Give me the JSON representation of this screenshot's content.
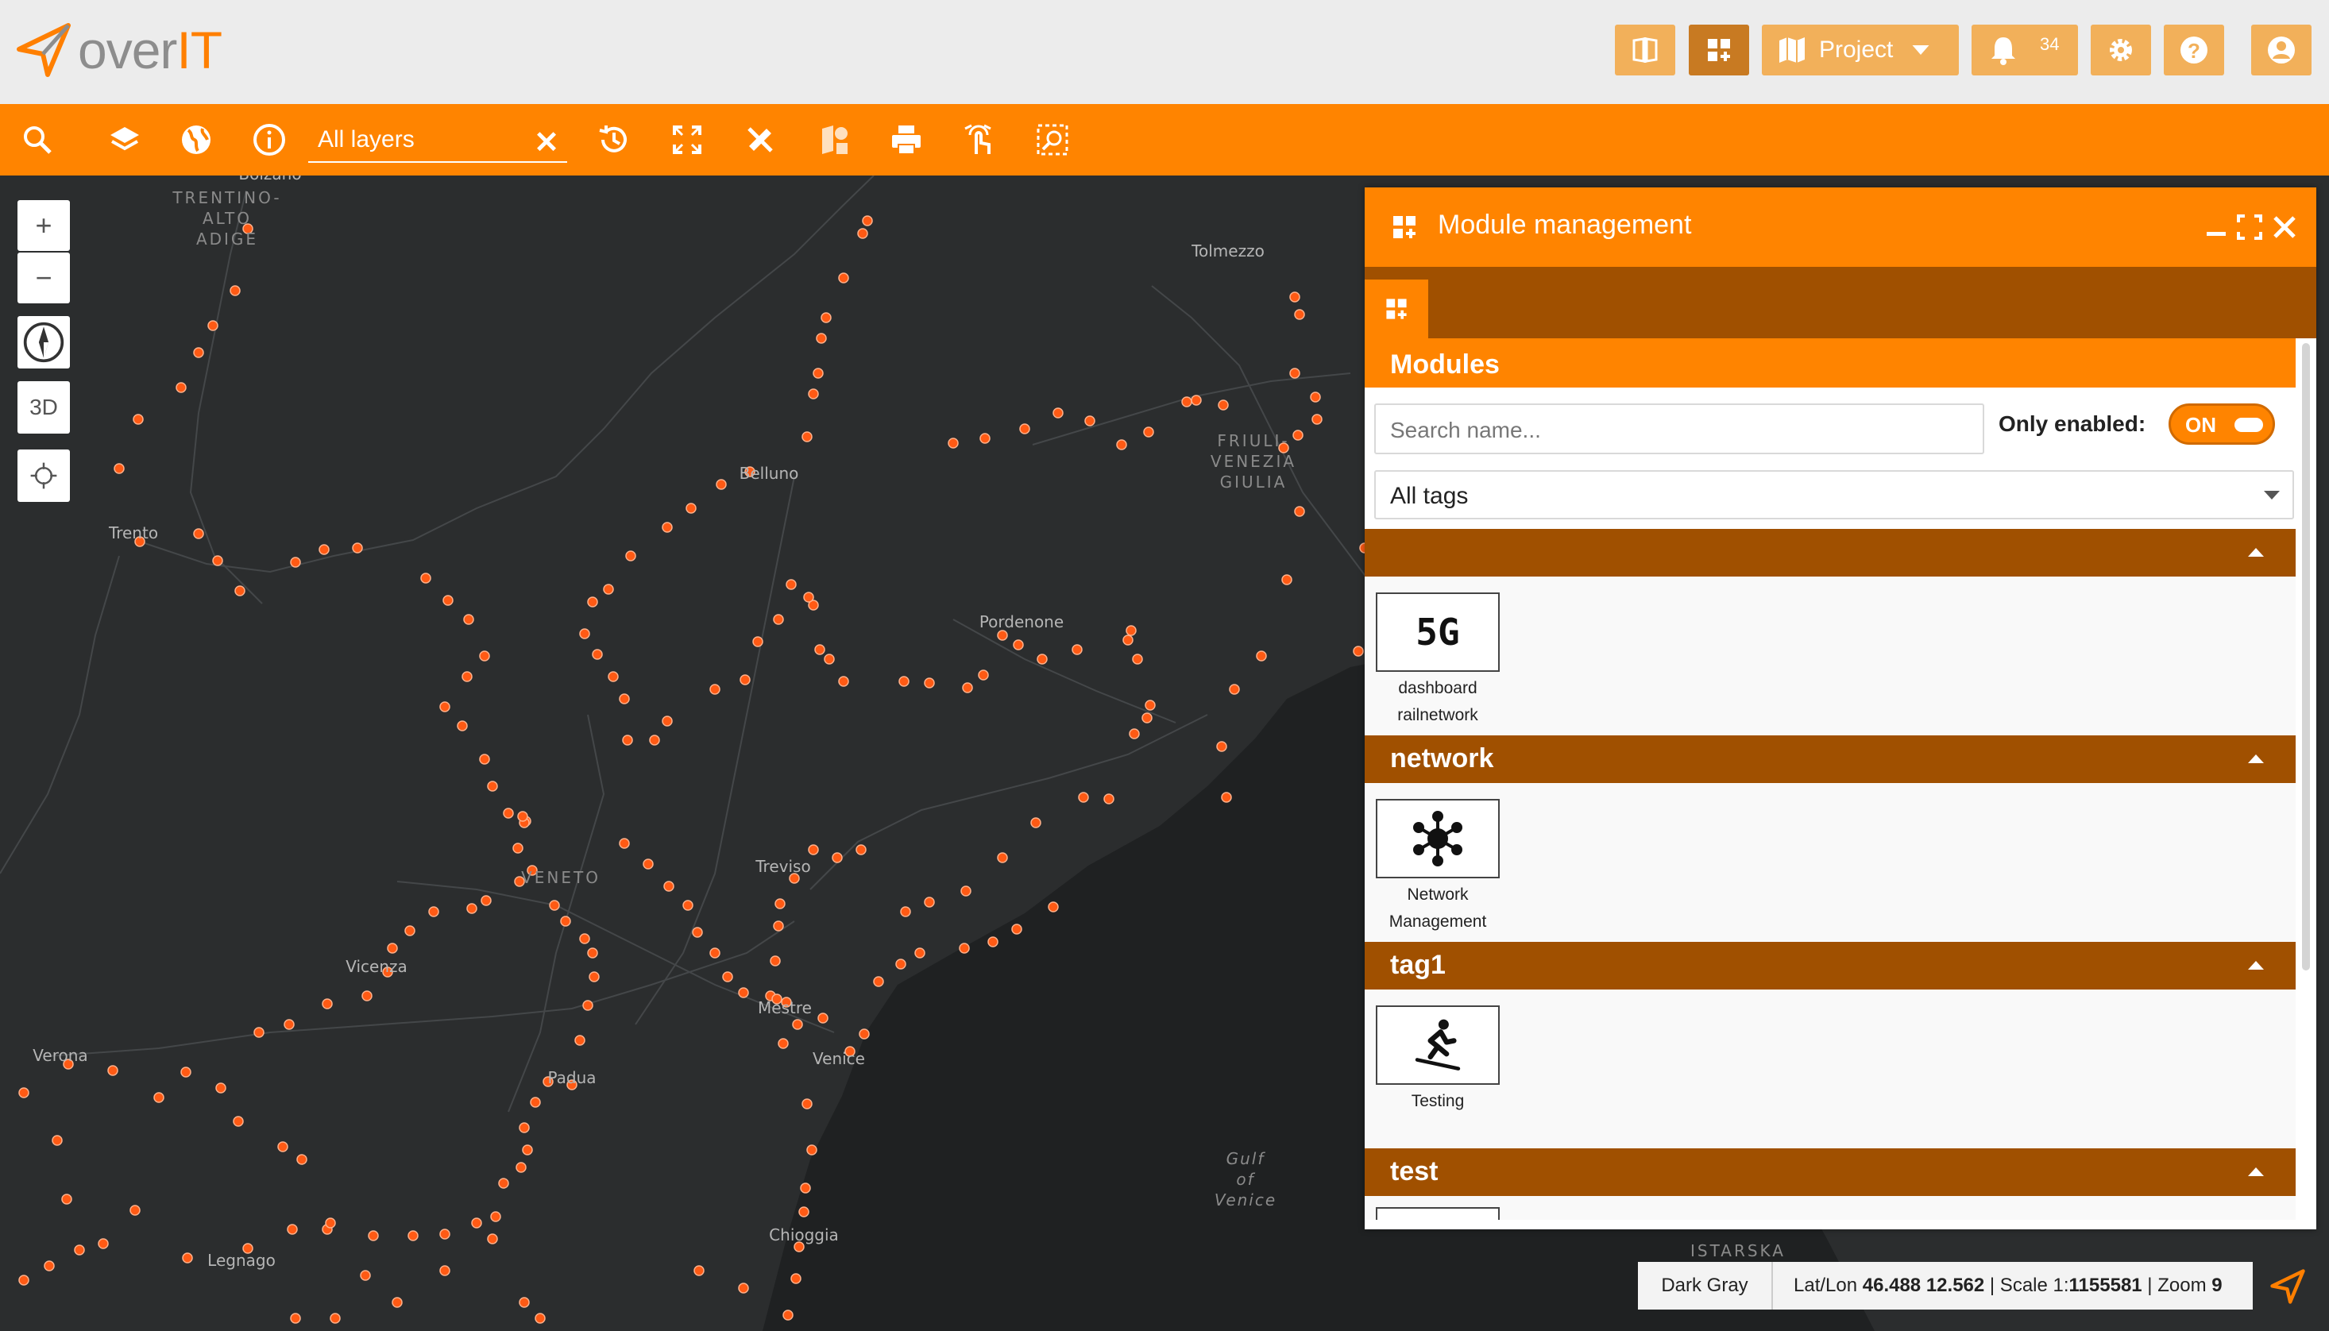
{
  "app": {
    "logo_text_plain": "over",
    "logo_text_accent": "IT"
  },
  "header": {
    "project_label": "Project",
    "notifications_count": "34",
    "buttons": [
      "split-view-icon",
      "module-add-icon",
      "map-icon",
      "bell-icon",
      "gear-icon",
      "help-icon",
      "user-icon"
    ]
  },
  "toolbar": {
    "layer_filter_value": "All layers",
    "clear_symbol": "✕",
    "tools": [
      "search-icon",
      "layers-icon",
      "globe-icon",
      "info-icon",
      "history-icon",
      "fullscreen-icon",
      "measure-icon",
      "select-features-icon",
      "print-icon",
      "touch-icon",
      "zoom-select-icon"
    ]
  },
  "map": {
    "controls": {
      "zoom_in": "+",
      "zoom_out": "−",
      "mode_3d": "3D"
    },
    "labels": {
      "bolzano": "Bolzano",
      "trentino1": "TRENTINO-",
      "trentino2": "ALTO",
      "trentino3": "ADIGE",
      "tolmezzo": "Tolmezzo",
      "friuli1": "FRIULI-",
      "friuli2": "VENEZIA",
      "friuli3": "GIULIA",
      "belluno": "Belluno",
      "trento": "Trento",
      "pordenone": "Pordenone",
      "veneto": "VENETO",
      "treviso": "Treviso",
      "vicenza": "Vicenza",
      "mestre": "Mestre",
      "verona": "Verona",
      "venice": "Venice",
      "padua": "Padua",
      "gulf1": "Gulf",
      "gulf2": "of",
      "gulf3": "Venice",
      "chioggia": "Chioggia",
      "legnago": "Legnago",
      "istarska": "ISTARSKA"
    },
    "colors": {
      "background": "#2b2d2e",
      "point": "#ff5a14",
      "land_line": "#4a4c4e"
    }
  },
  "panel": {
    "title": "Module management",
    "section_title": "Modules",
    "search_placeholder": "Search name...",
    "only_enabled_label": "Only enabled:",
    "toggle_label": "ON",
    "tags_select_value": "All tags",
    "groups": [
      {
        "name": "",
        "modules": [
          {
            "label1": "dashboard",
            "label2": "railnetwork",
            "icon_text": "5G"
          }
        ]
      },
      {
        "name": "network",
        "modules": [
          {
            "label1": "Network",
            "label2": "Management",
            "icon": "network-hub-icon"
          }
        ]
      },
      {
        "name": "tag1",
        "modules": [
          {
            "label1": "Testing",
            "label2": "",
            "icon": "skier-icon"
          }
        ]
      },
      {
        "name": "test",
        "modules": []
      }
    ]
  },
  "status": {
    "basemap": "Dark Gray",
    "coords_prefix": "Lat/Lon ",
    "latlon": "46.488 12.562",
    "scale_prefix": " | Scale 1:",
    "scale": "1155581",
    "zoom_prefix": " | Zoom ",
    "zoom": "9"
  },
  "brand_colors": {
    "orange": "#ff8400",
    "dark_orange": "#a05000",
    "light_orange_button": "#f2b05a"
  }
}
